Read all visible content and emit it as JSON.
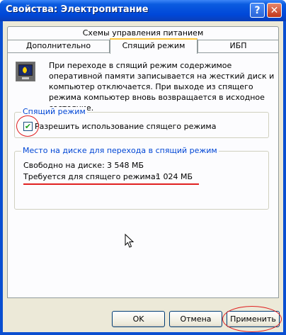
{
  "window": {
    "title": "Свойства: Электропитание"
  },
  "title_buttons": {
    "help": "?",
    "close": "✕"
  },
  "tabs": {
    "row1": "Схемы управления питанием",
    "dop": "Дополнительно",
    "sleep": "Спящий режим",
    "ups": "ИБП"
  },
  "description": "При переходе в спящий режим содержимое оперативной памяти записывается на жесткий диск и компьютер отключается. При выходе из спящего режима компьютер вновь возвращается в исходное состояние.",
  "hibernate_group": {
    "legend": "Спящий режим",
    "checkbox_label": "Разрешить использование спящего режима",
    "checked": true
  },
  "disk_group": {
    "legend": "Место на диске для перехода в спящий режим",
    "free_label": "Свободно на диске:",
    "free_value": "3 548 МБ",
    "required_label": "Требуется для спящего режима:",
    "required_value": "1 024 МБ"
  },
  "buttons": {
    "ok": "OK",
    "cancel": "Отмена",
    "apply": "Применить"
  },
  "icons": {
    "window": "power-icon",
    "feature": "hibernate-moon-icon",
    "cursor": "mouse-pointer-icon"
  },
  "colors": {
    "titlebar": "#0a5be0",
    "annotation": "#e02020",
    "group_legend": "#0046d5",
    "check": "#21a121"
  }
}
